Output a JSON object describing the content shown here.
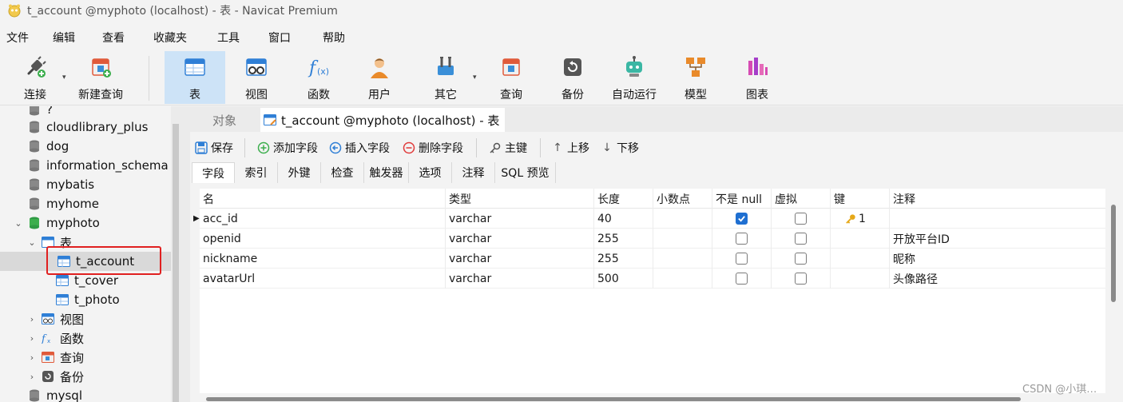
{
  "window": {
    "title": "t_account @myphoto (localhost) - 表 - Navicat Premium"
  },
  "menu": [
    "文件",
    "编辑",
    "查看",
    "收藏夹",
    "工具",
    "窗口",
    "帮助"
  ],
  "toolbar": {
    "connect": "连接",
    "new_query": "新建查询",
    "table": "表",
    "view": "视图",
    "function": "函数",
    "user": "用户",
    "other": "其它",
    "query": "查询",
    "backup": "备份",
    "automation": "自动运行",
    "model": "模型",
    "chart": "图表"
  },
  "tree": {
    "partial_top": "?",
    "databases_before": [
      "cloudlibrary_plus",
      "dog",
      "information_schema",
      "mybatis",
      "myhome"
    ],
    "open_db": "myphoto",
    "tables_group": "表",
    "tables": [
      "t_account",
      "t_cover",
      "t_photo"
    ],
    "groups": [
      "视图",
      "函数",
      "查询",
      "备份"
    ],
    "databases_after": [
      "mysql"
    ]
  },
  "tabs": {
    "objects": "对象",
    "active": "t_account @myphoto (localhost) - 表"
  },
  "editor_toolbar": {
    "save": "保存",
    "add_field": "添加字段",
    "insert_field": "插入字段",
    "delete_field": "删除字段",
    "primary_key": "主键",
    "move_up": "上移",
    "move_down": "下移"
  },
  "subtabs": [
    "字段",
    "索引",
    "外键",
    "检查",
    "触发器",
    "选项",
    "注释",
    "SQL 预览"
  ],
  "grid": {
    "columns": [
      "名",
      "类型",
      "长度",
      "小数点",
      "不是 null",
      "虚拟",
      "键",
      "注释"
    ],
    "rows": [
      {
        "name": "acc_id",
        "type": "varchar",
        "length": "40",
        "decimal": "",
        "not_null": true,
        "virtual": false,
        "key": "1",
        "comment": ""
      },
      {
        "name": "openid",
        "type": "varchar",
        "length": "255",
        "decimal": "",
        "not_null": false,
        "virtual": false,
        "key": "",
        "comment": "开放平台ID"
      },
      {
        "name": "nickname",
        "type": "varchar",
        "length": "255",
        "decimal": "",
        "not_null": false,
        "virtual": false,
        "key": "",
        "comment": "昵称"
      },
      {
        "name": "avatarUrl",
        "type": "varchar",
        "length": "500",
        "decimal": "",
        "not_null": false,
        "virtual": false,
        "key": "",
        "comment": "头像路径"
      }
    ]
  },
  "watermark": "CSDN @小琪…",
  "colors": {
    "accent": "#1f6fd1",
    "active_toolbar": "#cde3f7",
    "highlight": "#e02020"
  }
}
